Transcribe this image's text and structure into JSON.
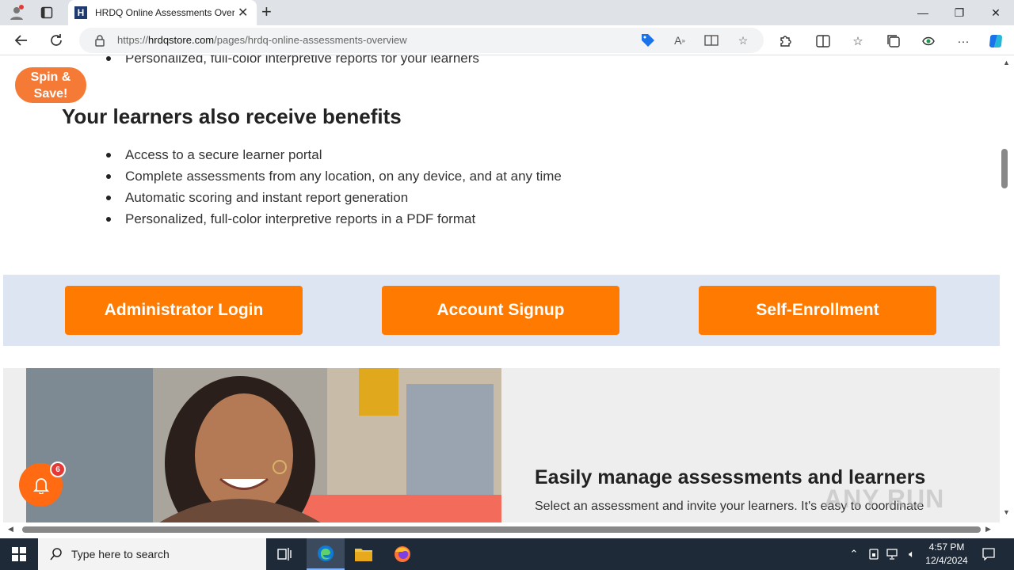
{
  "browser": {
    "tab_title": "HRDQ Online Assessments Overview",
    "url_scheme": "https://",
    "url_host": "hrdqstore.com",
    "url_path": "/pages/hrdq-online-assessments-overview",
    "tab_close_glyph": "✕",
    "new_tab_glyph": "+",
    "window_controls": {
      "minimize": "—",
      "restore": "❐",
      "close": "✕"
    },
    "favicon_letter": "H"
  },
  "page": {
    "top_bullet": "Personalized, full-color interpretive reports for your learners",
    "spin_badge": "Spin & Save!",
    "benefits_heading": "Your learners also receive benefits",
    "benefits": [
      "Access to a secure learner portal",
      "Complete assessments from any location, on any device, and at any time",
      "Automatic scoring and instant report generation",
      "Personalized, full-color interpretive reports in a PDF format"
    ],
    "cta_buttons": {
      "admin_login": "Administrator Login",
      "account_signup": "Account Signup",
      "self_enrollment": "Self-Enrollment"
    },
    "feature_heading": "Easily manage assessments and learners",
    "feature_text": "Select an assessment and invite your learners. It's easy to coordinate",
    "notification_count": "6",
    "watermark": "ANY RUN"
  },
  "taskbar": {
    "search_placeholder": "Type here to search",
    "time": "4:57 PM",
    "date": "12/4/2024"
  },
  "colors": {
    "accent_orange": "#ff7a00",
    "badge_orange": "#f47a36",
    "cta_band": "#dde4f2",
    "taskbar": "#1f2a38"
  }
}
